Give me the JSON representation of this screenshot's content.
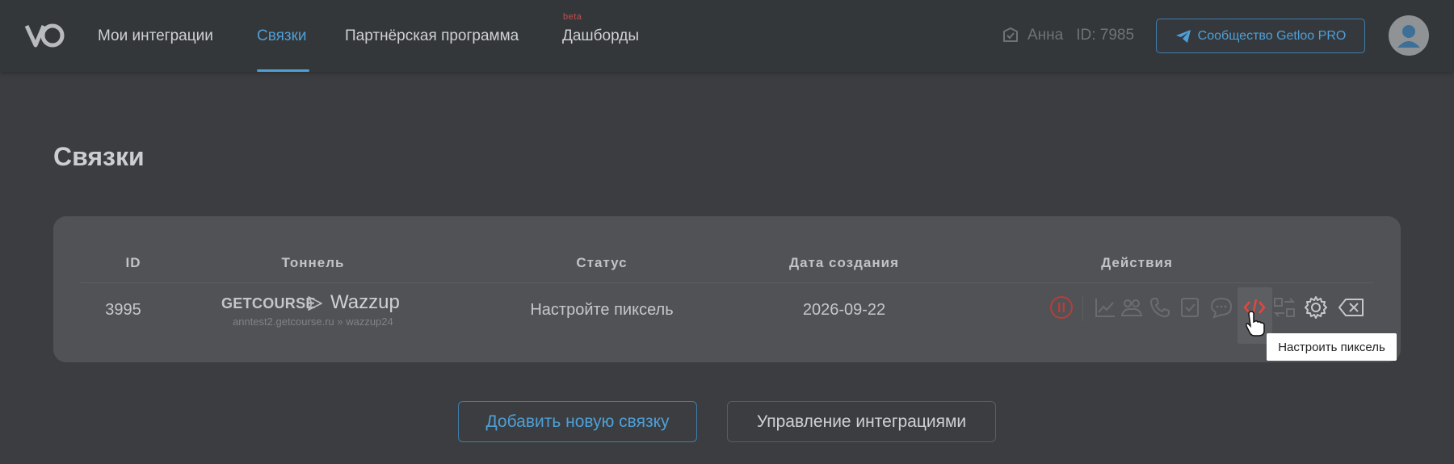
{
  "header": {
    "logo_icon": "vo-logo-icon",
    "nav": [
      {
        "label": "Мои интеграции",
        "active": false
      },
      {
        "label": "Связки",
        "active": true
      },
      {
        "label": "Партнёрская программа",
        "active": false
      },
      {
        "label": "Дашборды",
        "active": false
      }
    ],
    "beta_badge": "beta",
    "user": {
      "name": "Анна",
      "id_text": "ID: 7985",
      "icon": "verified-icon"
    },
    "community_button": {
      "label": "Сообщество Getloo PRO",
      "icon": "telegram-icon"
    },
    "avatar_icon": "user-avatar-icon"
  },
  "page": {
    "title": "Связки"
  },
  "table": {
    "columns": [
      "ID",
      "Тоннель",
      "Статус",
      "Дата создания",
      "Действия"
    ],
    "rows": [
      {
        "id": "3995",
        "tunnel": {
          "source": "GETCOURSE",
          "target": "Wazzup",
          "subtitle": "anntest2.getcourse.ru » wazzup24"
        },
        "status": "Настройте пиксель",
        "created": "2026-09-22",
        "actions": [
          "pause-icon",
          "chart-icon",
          "group-icon",
          "phone-icon",
          "task-icon",
          "chat-icon",
          "code-icon",
          "swap-icon",
          "gear-icon",
          "delete-icon"
        ]
      }
    ]
  },
  "tooltip": {
    "text": "Настроить пиксель"
  },
  "buttons": {
    "add": "Добавить новую связку",
    "manage": "Управление интеграциями"
  },
  "colors": {
    "accent": "#4f9fd6",
    "danger": "#c94541",
    "background": "#3b3d40",
    "card": "#505255"
  }
}
